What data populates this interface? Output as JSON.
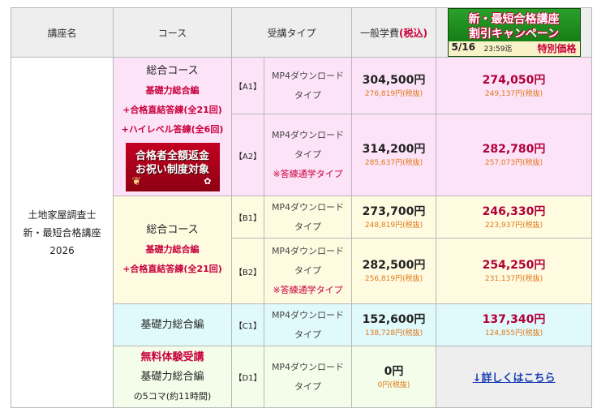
{
  "headers": {
    "course_name": "講座名",
    "course": "コース",
    "type": "受講タイプ",
    "price": "一般学費",
    "price_tax": "(税込)"
  },
  "banner": {
    "line1": "新・最短合格講座",
    "line2": "割引キャンペーン",
    "date": "5/16",
    "time": "23:59迄",
    "special": "特別価格"
  },
  "course_name": {
    "line1": "土地家屋調査士",
    "line2": "新・最短合格講座",
    "line3": "2026"
  },
  "groupA": {
    "title": "総合コース",
    "sub1": "基礎力総合編",
    "sub2": "+合格直結答練(全21回)",
    "sub3": "+ハイレベル答練(全6回)",
    "promo1": "合格者全額返金",
    "promo2": "お祝い制度対象"
  },
  "groupB": {
    "title": "総合コース",
    "sub1": "基礎力総合編",
    "sub2": "+合格直結答練(全21回)"
  },
  "groupC": {
    "title": "基礎力総合編"
  },
  "groupD": {
    "title": "無料体験受講",
    "sub1": "基礎力総合編",
    "sub2": "の5コマ(約11時間)"
  },
  "rows": [
    {
      "code": "【A1】",
      "type1": "MP4ダウンロード",
      "type2": "タイプ",
      "note": "",
      "price": "304,500円",
      "price_ex": "276,819円(税抜)",
      "sale": "274,050円",
      "sale_ex": "249,137円(税抜)"
    },
    {
      "code": "【A2】",
      "type1": "MP4ダウンロード",
      "type2": "タイプ",
      "note": "※答練通学タイプ",
      "price": "314,200円",
      "price_ex": "285,637円(税抜)",
      "sale": "282,780円",
      "sale_ex": "257,073円(税抜)"
    },
    {
      "code": "【B1】",
      "type1": "MP4ダウンロード",
      "type2": "タイプ",
      "note": "",
      "price": "273,700円",
      "price_ex": "248,819円(税抜)",
      "sale": "246,330円",
      "sale_ex": "223,937円(税抜)"
    },
    {
      "code": "【B2】",
      "type1": "MP4ダウンロード",
      "type2": "タイプ",
      "note": "※答練通学タイプ",
      "price": "282,500円",
      "price_ex": "256,819円(税抜)",
      "sale": "254,250円",
      "sale_ex": "231,137円(税抜)"
    },
    {
      "code": "【C1】",
      "type1": "MP4ダウンロード",
      "type2": "タイプ",
      "note": "",
      "price": "152,600円",
      "price_ex": "138,728円(税抜)",
      "sale": "137,340円",
      "sale_ex": "124,855円(税抜)"
    },
    {
      "code": "【D1】",
      "type1": "MP4ダウンロード",
      "type2": "タイプ",
      "note": "",
      "price": "0円",
      "price_ex": "0円(税抜)"
    }
  ],
  "details_link": "↓詳しくはこちら"
}
